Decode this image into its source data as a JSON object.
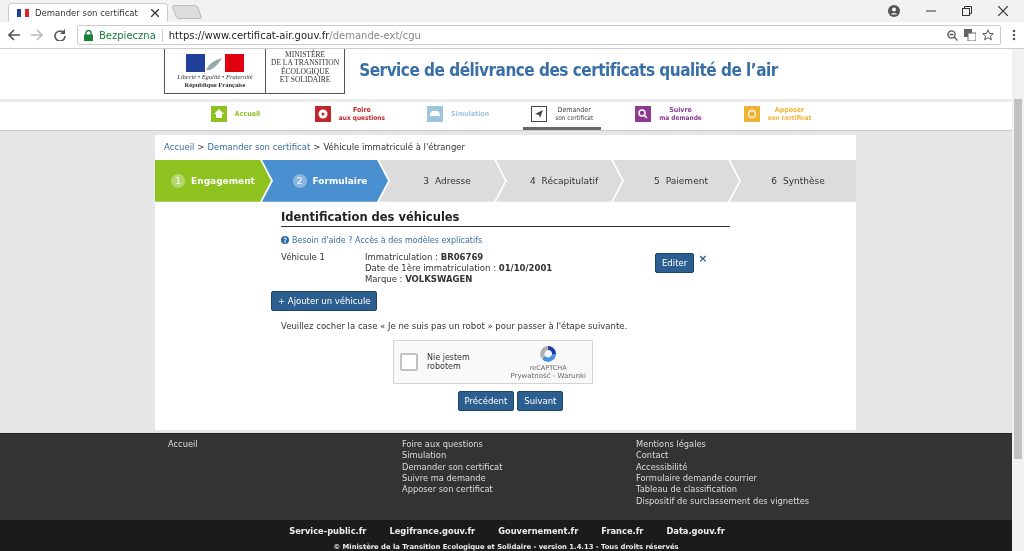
{
  "browser": {
    "tab_title": "Demander son certificat",
    "secure_label": "Bezpieczna",
    "url_host": "https://www.certificat-air.gouv.fr",
    "url_path": "/demande-ext/cgu"
  },
  "header": {
    "logo_motto": "Liberté • Égalité • Fraternité",
    "logo_country": "République Française",
    "ministry": [
      "MINISTÈRE",
      "DE LA TRANSITION",
      "ÉCOLOGIQUE",
      "ET SOLIDAIRE"
    ],
    "title": "Service de délivrance des certificats qualité de l’air"
  },
  "nav": [
    {
      "line1": "Accueil",
      "color": "#8dc21f",
      "selected": false
    },
    {
      "line1": "Foire",
      "line2": "aux questions",
      "color": "#c0272d",
      "selected": false
    },
    {
      "line1": "Simulation",
      "color": "#9fc5de",
      "selected": false
    },
    {
      "line1": "Demander",
      "line2": "son certificat",
      "color": "#444444",
      "selected": true
    },
    {
      "line1": "Suivre",
      "line2": "ma demande",
      "color": "#8e3a8f",
      "selected": false
    },
    {
      "line1": "Apposer",
      "line2": "son certificat",
      "color": "#f2b233",
      "selected": false
    }
  ],
  "breadcrumb": [
    {
      "label": "Accueil",
      "link": true
    },
    {
      "separator": ">",
      "label": "Demander son certificat",
      "link": true
    },
    {
      "separator": ">",
      "label": "Véhicule immatriculé à l'étranger",
      "link": false
    }
  ],
  "steps": [
    {
      "number": "1",
      "label": "Engagement",
      "completed": true,
      "selected": false
    },
    {
      "number": "2",
      "label": "Formulaire",
      "completed": false,
      "selected": true
    },
    {
      "number": "3",
      "label": "Adresse",
      "completed": false,
      "selected": false
    },
    {
      "number": "4",
      "label": "Récapitulatif",
      "completed": false,
      "selected": false
    },
    {
      "number": "5",
      "label": "Paiement",
      "completed": false,
      "selected": false
    },
    {
      "number": "6",
      "label": "Synthèse",
      "completed": false,
      "selected": false
    }
  ],
  "form": {
    "heading": "Identification des véhicules",
    "help_link": "Besoin d'aide ? Accès à des modèles explicatifs",
    "vehicles": [
      {
        "name": "Véhicule 1",
        "details": [
          "Immatriculation : **BR06769**",
          "Date de 1ère immatriculation : **01/10/2001**",
          "Marque : **VOLKSWAGEN**"
        ],
        "edit_button": "Editer",
        "remove": "×"
      }
    ],
    "add_button": "+ Ajouter un véhicule",
    "captcha_note": "Veuillez cocher la case « Je ne suis pas un robot » pour passer à l'étape suivante.",
    "captcha": {
      "label": "Nie jestem robotem",
      "checked": false,
      "brand": "reCAPTCHA",
      "terms": "Prywatność - Warunki"
    },
    "prev_button": "Précédent",
    "next_button": "Suivant"
  },
  "footer": {
    "columns": [
      [
        "Accueil"
      ],
      [
        "Foire aux questions",
        "Simulation",
        "Demander son certificat",
        "Suivre ma demande",
        "Apposer son certificat"
      ],
      [
        "Mentions légales",
        "Contact",
        "Accessibilité",
        "Formulaire demande courrier",
        "Tableau de classification",
        "Dispositif de surclassement des vignettes"
      ]
    ],
    "links": [
      "Service-public.fr",
      "Legifrance.gouv.fr",
      "Gouvernement.fr",
      "France.fr",
      "Data.gouv.fr"
    ],
    "copyright": "© Ministère de la Transition Ecologique et Solidaire - version 1.4.13 - Tous droits réservés"
  }
}
